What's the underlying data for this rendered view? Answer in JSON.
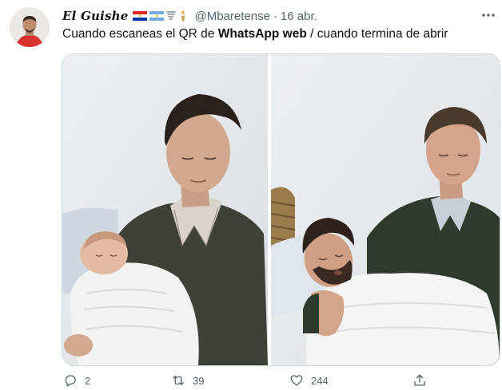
{
  "tweet": {
    "display_name": "El Guishe",
    "flag_icons": [
      "paraguay-flag-icon",
      "argentina-flag-icon",
      "tornado-icon",
      "torch-icon"
    ],
    "handle": "@Mbaretense",
    "separator": "·",
    "date": "16 abr.",
    "more_icon": "more-horizontal-icon",
    "text_part1": "Cuando escaneas el QR de ",
    "text_bold": "WhatsApp web",
    "text_part2": " /  cuando termina de abrir"
  },
  "media": {
    "left_photo": "photo-man-holding-newborn",
    "right_photo": "photo-man-holding-grown-son"
  },
  "actions": {
    "reply_count": "2",
    "retweet_count": "39",
    "like_count": "244",
    "reply_icon": "reply-icon",
    "retweet_icon": "retweet-icon",
    "like_icon": "heart-icon",
    "share_icon": "share-icon"
  },
  "colors": {
    "text_primary": "#0f1419",
    "text_secondary": "#536471",
    "border": "#cfd9de"
  }
}
